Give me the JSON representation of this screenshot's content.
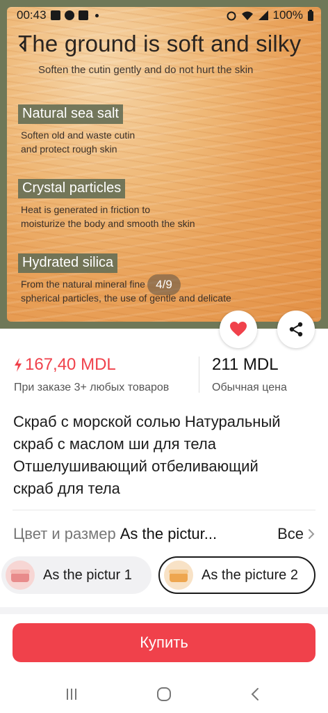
{
  "status_bar": {
    "time": "00:43",
    "battery": "100%"
  },
  "gallery": {
    "headline": "The ground is soft and silky",
    "subheadline": "Soften the cutin gently and do not hurt the skin",
    "features": [
      {
        "label": "Natural sea salt",
        "desc_lines": [
          "Soften old and waste cutin",
          "and protect rough skin"
        ]
      },
      {
        "label": "Crystal particles",
        "desc_lines": [
          "Heat is generated in friction to",
          "moisturize the body and smooth the skin"
        ]
      },
      {
        "label": "Hydrated silica",
        "desc_lines": [
          "From the natural mineral fine",
          "spherical particles, the use of gentle and delicate"
        ]
      }
    ],
    "page_indicator": "4/9",
    "current_page": 4,
    "total_pages": 9
  },
  "price": {
    "sale_price": "167,40 MDL",
    "sale_note": "При заказе 3+ любых товаров",
    "regular_price": "211 MDL",
    "regular_note": "Обычная цена"
  },
  "product_title_lines": [
    "Скраб с морской солью Натуральный",
    "скраб с маслом ши для тела",
    "Отшелушивающий отбеливающий",
    "скраб для тела"
  ],
  "variant": {
    "label": "Цвет и размер",
    "selected": "As the pictur...",
    "all_label": "Все",
    "options": [
      {
        "label": "As the pictur 1",
        "selected": false
      },
      {
        "label": "As the picture 2",
        "selected": true
      }
    ]
  },
  "buy_button": {
    "label": "Купить"
  },
  "colors": {
    "accent_red": "#f0414b",
    "image_frame": "#6f7858",
    "tag_bg": "#687056"
  },
  "icons": [
    "back-arrow-icon",
    "heart-icon",
    "share-icon",
    "lightning-icon",
    "chevron-right-icon",
    "recent-apps-icon",
    "home-icon",
    "back-nav-icon"
  ]
}
